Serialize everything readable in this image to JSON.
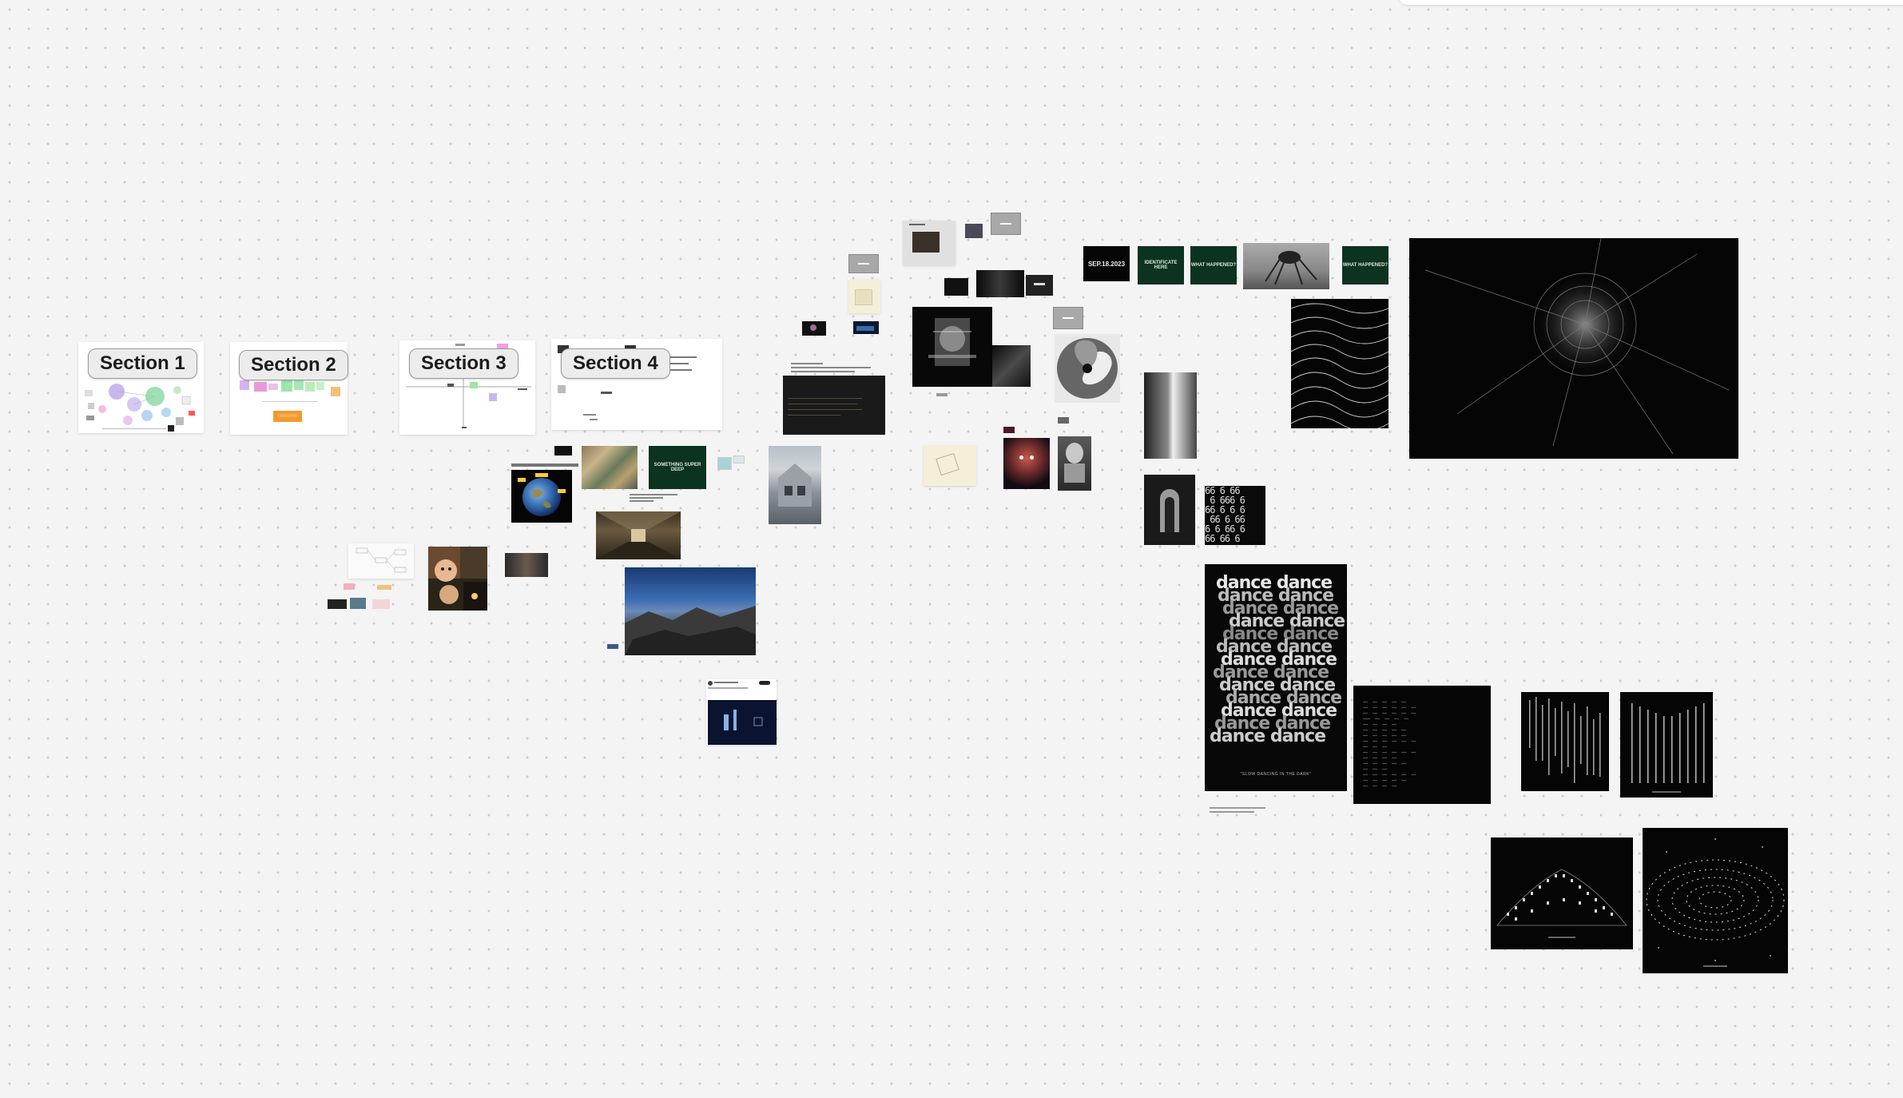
{
  "sections": [
    {
      "label": "Section 1"
    },
    {
      "label": "Section 2"
    },
    {
      "label": "Section 3"
    },
    {
      "label": "Section 4"
    }
  ],
  "images": {
    "date_card": "SEP.18.2023",
    "green_card_1": "IDENTIFICATE HERE",
    "green_card_2": "WHAT HAPPENED?",
    "green_card_3": "WHAT HAPPENED?",
    "dance_word": "dance dance",
    "dance_caption": "\"SLOW DANCING IN THE DARK\"",
    "green_poster": "SOMETHING SUPER DEEP"
  },
  "colors": {
    "canvas_bg": "#f4f4f4",
    "dot_grid": "#c9c9c9",
    "section_label_bg": "#ececec",
    "green_card": "#0c3320"
  }
}
